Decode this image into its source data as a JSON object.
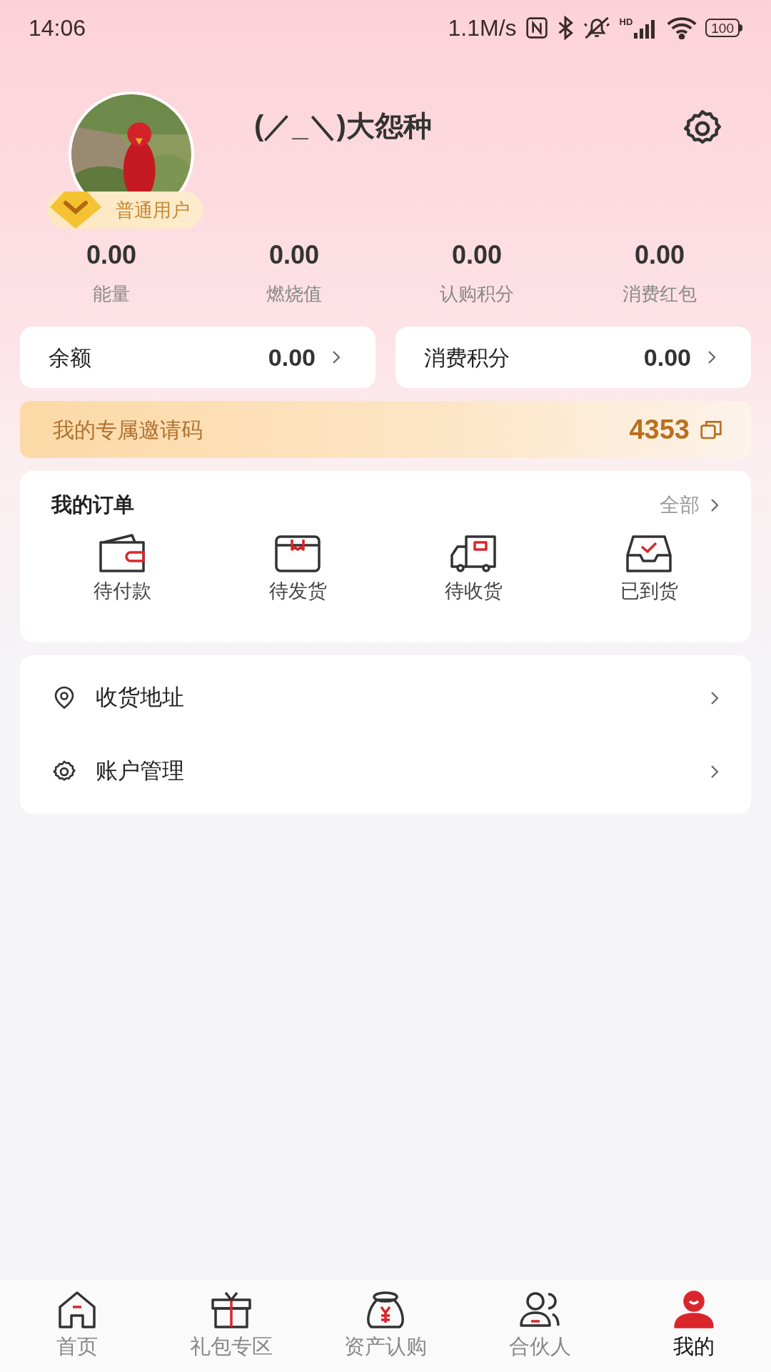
{
  "status_bar": {
    "time": "14:06",
    "net_speed": "1.1M/s",
    "signal_label": "HD",
    "battery": "100"
  },
  "profile": {
    "name": "(／_＼)大怨种",
    "badge": "普通用户"
  },
  "stats": [
    {
      "value": "0.00",
      "label": "能量"
    },
    {
      "value": "0.00",
      "label": "燃烧值"
    },
    {
      "value": "0.00",
      "label": "认购积分"
    },
    {
      "value": "0.00",
      "label": "消费红包"
    }
  ],
  "balance_cards": [
    {
      "label": "余额",
      "value": "0.00"
    },
    {
      "label": "消费积分",
      "value": "0.00"
    }
  ],
  "invite": {
    "label": "我的专属邀请码",
    "code": "4353"
  },
  "orders": {
    "title": "我的订单",
    "all": "全部",
    "items": [
      {
        "kind": "wallet",
        "label": "待付款"
      },
      {
        "kind": "box",
        "label": "待发货"
      },
      {
        "kind": "truck",
        "label": "待收货"
      },
      {
        "kind": "tray",
        "label": "已到货"
      }
    ]
  },
  "menu": [
    {
      "kind": "location",
      "label": "收货地址"
    },
    {
      "kind": "gear",
      "label": "账户管理"
    }
  ],
  "nav": [
    {
      "kind": "home",
      "label": "首页",
      "selected": false
    },
    {
      "kind": "gift",
      "label": "礼包专区",
      "selected": false
    },
    {
      "kind": "bag",
      "label": "资产认购",
      "selected": false
    },
    {
      "kind": "people",
      "label": "合伙人",
      "selected": false
    },
    {
      "kind": "user",
      "label": "我的",
      "selected": true
    }
  ]
}
